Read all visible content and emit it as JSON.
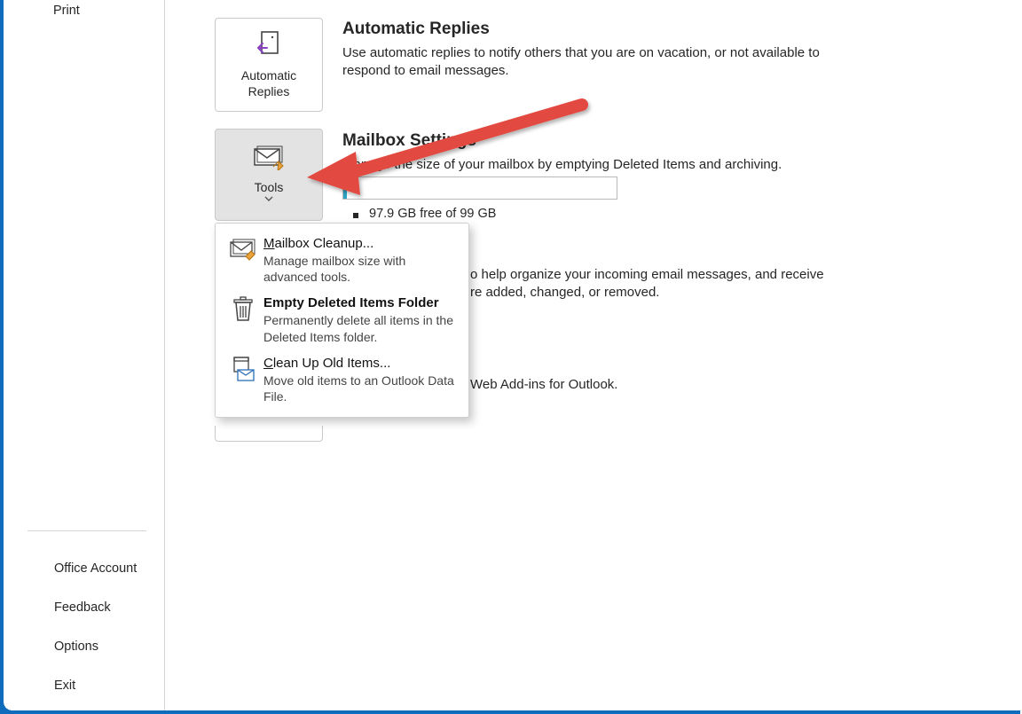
{
  "sidebar": {
    "print": "Print",
    "office_account": "Office Account",
    "feedback": "Feedback",
    "options": "Options",
    "exit": "Exit"
  },
  "auto_replies": {
    "card_label": "Automatic\nReplies",
    "title": "Automatic Replies",
    "desc": "Use automatic replies to notify others that you are on vacation, or not available to respond to email messages."
  },
  "mailbox": {
    "card_label": "Tools",
    "title": "Mailbox Settings",
    "desc": "Manage the size of your mailbox by emptying Deleted Items and archiving.",
    "storage_text": "97.9 GB free of 99 GB",
    "progress_pct": 1.1
  },
  "rules": {
    "desc_fragment_1": "o help organize your incoming email messages, and receive",
    "desc_fragment_2": "re added, changed, or removed."
  },
  "addins": {
    "desc_fragment": "Web Add-ins for Outlook."
  },
  "popup": {
    "items": [
      {
        "title_pre": "M",
        "title_rest": "ailbox Cleanup...",
        "desc": "Manage mailbox size with advanced tools."
      },
      {
        "title_pre": "",
        "title_bold": "Empty Deleted Items Folder",
        "desc": "Permanently delete all items in the Deleted Items folder."
      },
      {
        "title_pre": "C",
        "title_rest": "lean Up Old Items...",
        "desc": "Move old items to an Outlook Data File."
      }
    ]
  },
  "colors": {
    "accent": "#0f6cbd",
    "arrow": "#e24a3f"
  }
}
